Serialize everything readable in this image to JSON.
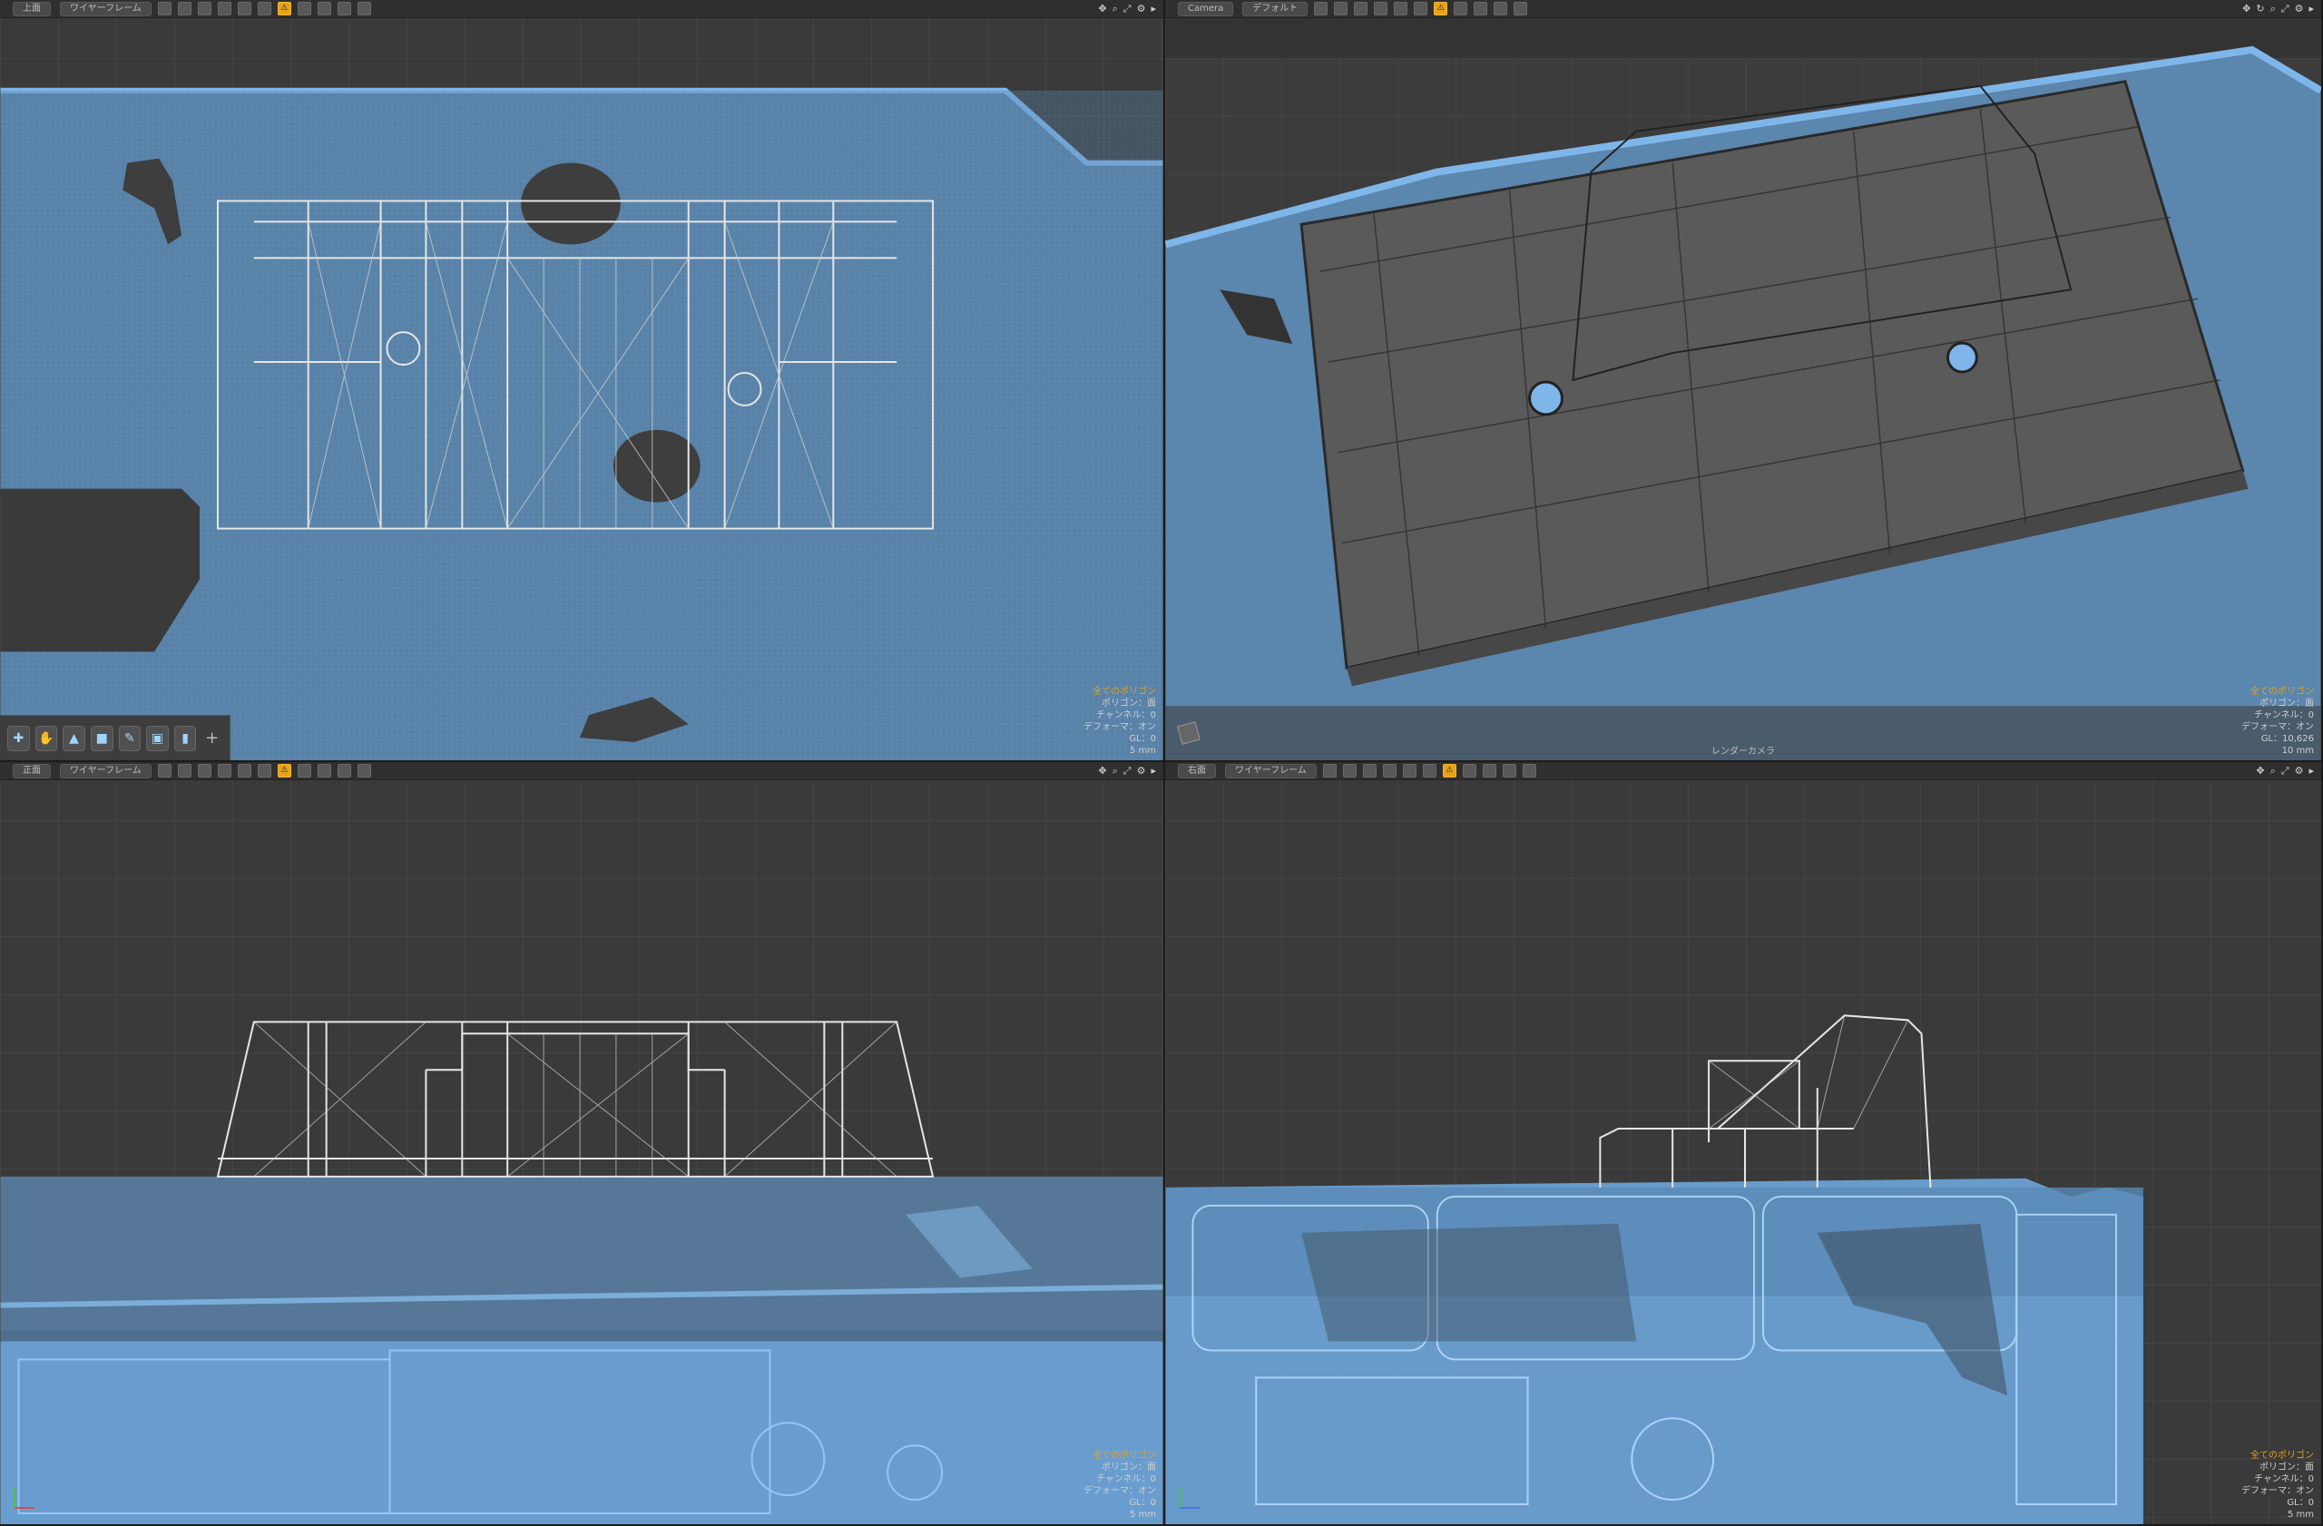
{
  "viewports": [
    {
      "id": "top-left",
      "view_label": "上面",
      "shading_label": "ワイヤーフレーム",
      "stats": [
        "全てのポリゴン",
        "ポリゴン：面",
        "チャンネル：0",
        "デフォーマ：オン",
        "GL：0",
        "5 mm"
      ]
    },
    {
      "id": "top-right",
      "view_label": "Camera",
      "shading_label": "デフォルト",
      "stats": [
        "全てのポリゴン",
        "ポリゴン：面",
        "チャンネル：0",
        "デフォーマ：オン",
        "GL：10,626",
        "10 mm"
      ],
      "footer_label": "レンダーカメラ"
    },
    {
      "id": "bottom-left",
      "view_label": "正面",
      "shading_label": "ワイヤーフレーム",
      "stats": [
        "全てのポリゴン",
        "ポリゴン：面",
        "チャンネル：0",
        "デフォーマ：オン",
        "GL：0",
        "5 mm"
      ]
    },
    {
      "id": "bottom-right",
      "view_label": "右面",
      "shading_label": "ワイヤーフレーム",
      "stats": [
        "全てのポリゴン",
        "ポリゴン：面",
        "チャンネル：0",
        "デフォーマ：オン",
        "GL：0",
        "5 mm"
      ]
    }
  ],
  "colors": {
    "scan_blue": "#5f93c6",
    "scan_dark": "#4a6f94",
    "wire": "#e6e6e6",
    "accent": "#e6a21a",
    "solid_gray": "#5a5a5a"
  }
}
